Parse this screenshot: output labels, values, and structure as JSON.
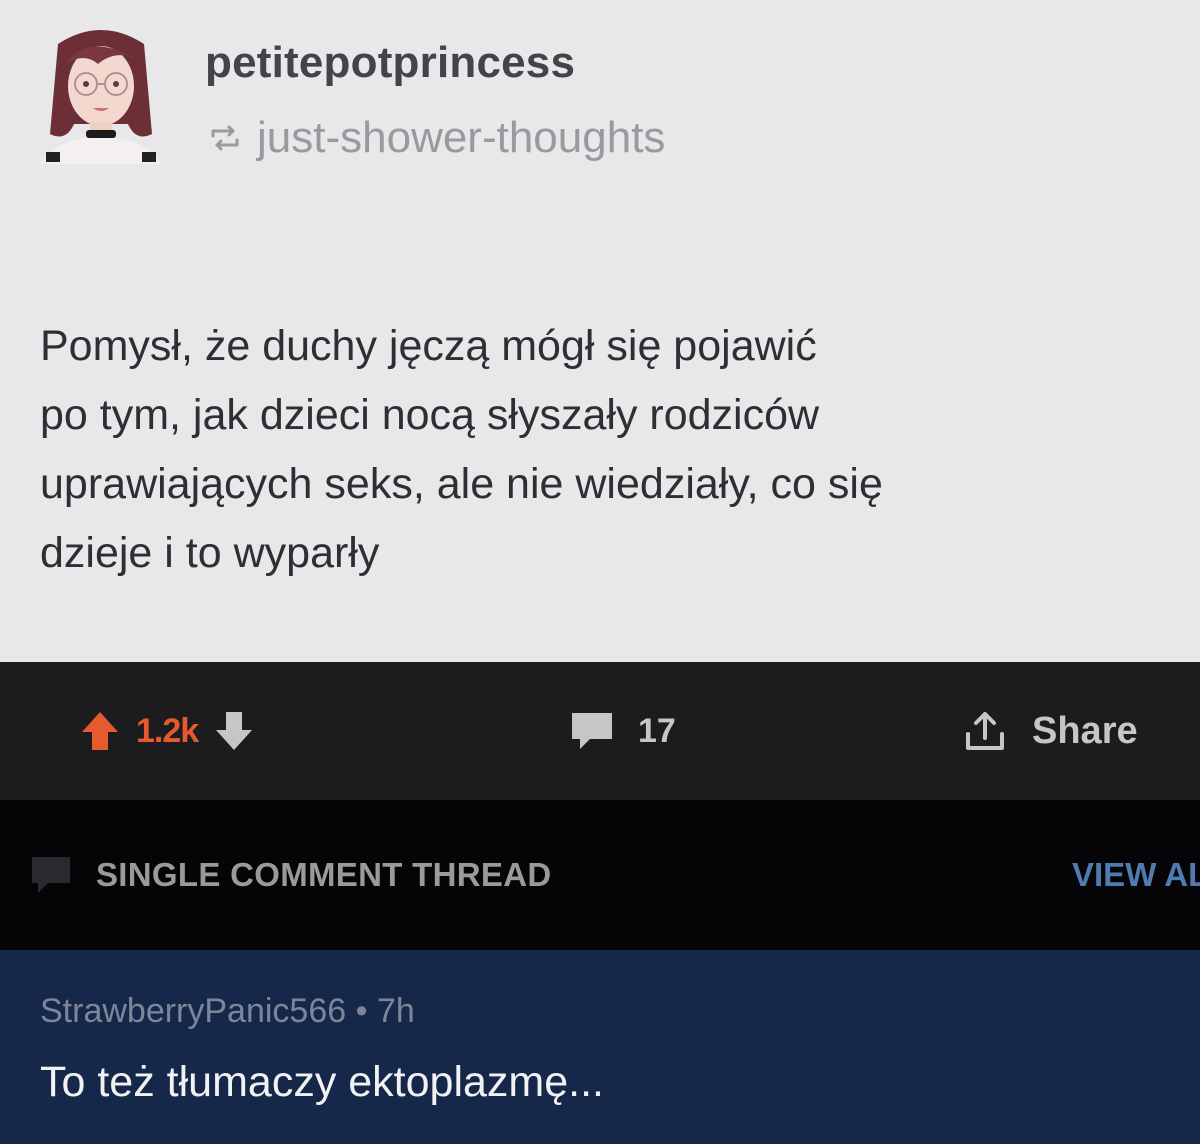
{
  "post": {
    "avatar_icon": "avatar-girl-icon",
    "username": "petitepotprincess",
    "reblog_icon": "reblog-icon",
    "reblogged_from": "just-shower-thoughts",
    "body_lines": [
      "Pomysł, że duchy jęczą mógł się pojawić",
      "po tym, jak dzieci nocą słyszały rodziców",
      "uprawiających seks, ale nie wiedziały, co się",
      "dzieje i to wyparły"
    ]
  },
  "actions": {
    "upvote_icon": "upvote-arrow-icon",
    "vote_count": "1.2k",
    "downvote_icon": "downvote-arrow-icon",
    "comment_icon": "comment-bubble-icon",
    "comment_count": "17",
    "share_icon": "share-icon",
    "share_label": "Share",
    "colors": {
      "upvote": "#e65a2e",
      "neutral": "#c6c6c8"
    }
  },
  "thread": {
    "icon": "comment-bubble-icon",
    "label": "SINGLE COMMENT THREAD",
    "view_all_label": "VIEW AL"
  },
  "comment": {
    "author": "StrawberryPanic566",
    "separator": "•",
    "age": "7h",
    "text": "To też tłumaczy ektoplazmę..."
  }
}
